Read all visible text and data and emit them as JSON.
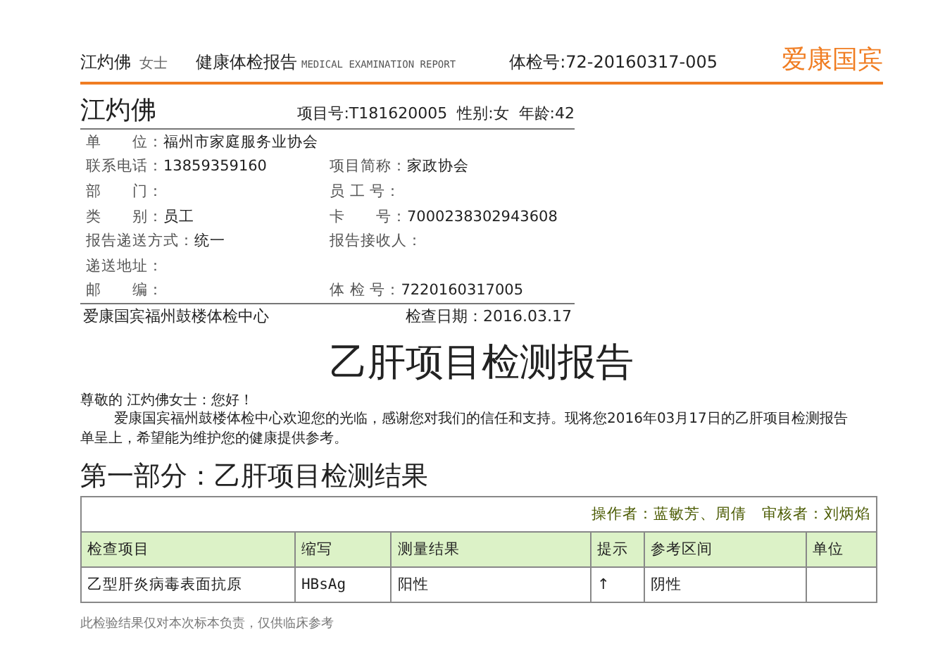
{
  "header": {
    "name": "江灼佛",
    "title_suffix": "女士",
    "report_title": "健康体检报告",
    "report_title_en": "MEDICAL EXAMINATION REPORT",
    "exam_no": "体检号:72-20160317-005",
    "brand": "爱康国宾"
  },
  "profile": {
    "name": "江灼佛",
    "summary": "项目号:T181620005  性别:女  年龄:42",
    "rows": [
      [
        {
          "label": "单　　位：",
          "value": "福州市家庭服务业协会"
        }
      ],
      [
        {
          "label": "联系电话：",
          "value": "13859359160"
        },
        {
          "label": "项目简称：",
          "value": "家政协会"
        }
      ],
      [
        {
          "label": "部　　门："
        },
        {
          "label": "员 工 号："
        }
      ],
      [
        {
          "label": "类　　别：",
          "value": "员工"
        },
        {
          "label": "卡　　号：",
          "value": "7000238302943608"
        }
      ],
      [
        {
          "label": "报告递送方式：",
          "value": "统一"
        },
        {
          "label": "报告接收人："
        }
      ],
      [
        {
          "label": "递送地址："
        }
      ],
      [
        {
          "label": "邮　　编："
        },
        {
          "label": "体 检 号：",
          "value": "7220160317005"
        }
      ]
    ],
    "center": "爱康国宾福州鼓楼体检中心",
    "date": "检查日期：2016.03.17"
  },
  "report_heading": "乙肝项目检测报告",
  "greeting": "尊敬的 江灼佛女士：您好！",
  "intro": "爱康国宾福州鼓楼体检中心欢迎您的光临，感谢您对我们的信任和支持。现将您2016年03月17日的乙肝项目检测报告单呈上，希望能为维护您的健康提供参考。",
  "section_heading": "第一部分：乙肝项目检测结果",
  "table": {
    "operators": "操作者：蓝敏芳、周倩　审核者：刘炳焰",
    "columns": [
      "检查项目",
      "缩写",
      "测量结果",
      "提示",
      "参考区间",
      "单位"
    ],
    "rows": [
      [
        "乙型肝炎病毒表面抗原",
        "HBsAg",
        "阳性",
        "↑",
        "阴性",
        null
      ]
    ]
  },
  "footnote": "此检验结果仅对本次标本负责，仅供临床参考"
}
